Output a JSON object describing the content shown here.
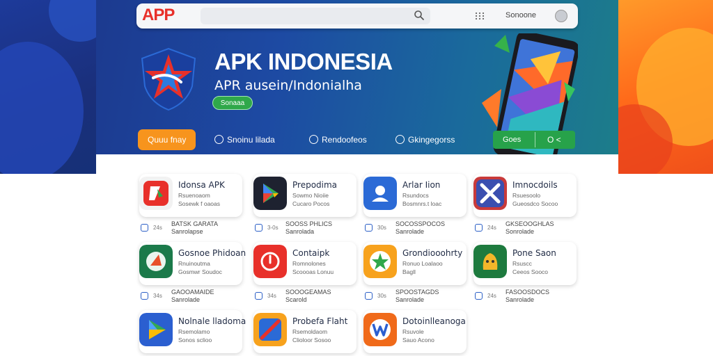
{
  "header": {
    "logo": "APP",
    "search_placeholder": "",
    "signin": "Sonoone"
  },
  "hero": {
    "title": "APK INDONESIA",
    "subtitle": "APR ausein/Indonialha",
    "button": "Sonaaa"
  },
  "tabs": [
    {
      "label": "Quuu fnay"
    },
    {
      "label": "Snoinu lilada"
    },
    {
      "label": "Rendoofeos"
    },
    {
      "label": "Gkingegorss"
    }
  ],
  "phone_buttons": {
    "left": "Goes",
    "right": "O <"
  },
  "apps": [
    {
      "name": "Idonsa APK",
      "line1": "Rsuenoaom",
      "line2": "Sosewk f oaoas",
      "meta_num": "24s",
      "meta1": "BATSK GARATA",
      "meta2": "Sanrolapse"
    },
    {
      "name": "Prepodima",
      "line1": "Sowmo Nioiie",
      "line2": "Cucaro Pocos",
      "meta_num": "3-0s",
      "meta1": "SOOSS PHLICS",
      "meta2": "Sanrolada"
    },
    {
      "name": "Arlar Iion",
      "line1": "Rsundocs",
      "line2": "Bosmnrs.t loac",
      "meta_num": "30s",
      "meta1": "SOCOSSPOCOS",
      "meta2": "Sanrolade"
    },
    {
      "name": "Imnocdoils",
      "line1": "Rsuesoolo",
      "line2": "Gueosdco Socoo",
      "meta_num": "24s",
      "meta1": "GKSEOOGHLAS",
      "meta2": "Sonrolade"
    },
    {
      "name": "Gosnoe Phidoan",
      "line1": "Rnuinoutma",
      "line2": "Gosmwr Soudoc",
      "meta_num": "34s",
      "meta1": "GAOOAMAIDE",
      "meta2": "Sanrolade"
    },
    {
      "name": "Contaipk",
      "line1": "Romnolones",
      "line2": "Scoooas Lonuu",
      "meta_num": "34s",
      "meta1": "SOOOGEAMAS",
      "meta2": "Scarold"
    },
    {
      "name": "Grondiooohrty",
      "line1": "Ronuo Loalaoo",
      "line2": "Bagll",
      "meta_num": "30s",
      "meta1": "SPOOSTAGDS",
      "meta2": "Sanrolade"
    },
    {
      "name": "Pone Saon",
      "line1": "Rsuscc",
      "line2": "Ceeos Sooco",
      "meta_num": "24s",
      "meta1": "FASOOSDOCS",
      "meta2": "Sanrolade"
    },
    {
      "name": "Nolnale lladoma",
      "line1": "Rsemolamo",
      "line2": "Sonos sclioo",
      "meta_num": "",
      "meta1": "",
      "meta2": ""
    },
    {
      "name": "Probefa Flaht",
      "line1": "Rsemoldaom",
      "line2": "Clioloor Sosoo",
      "meta_num": "",
      "meta1": "",
      "meta2": ""
    },
    {
      "name": "Dotoinlleanoga",
      "line1": "Rsuvole",
      "line2": "Sauo Acono",
      "meta_num": "",
      "meta1": "",
      "meta2": ""
    }
  ],
  "colors": {
    "brand_red": "#e8302a",
    "accent_orange": "#f7941d",
    "accent_green": "#2fa84a",
    "hero_blue": "#1d4aa3"
  }
}
